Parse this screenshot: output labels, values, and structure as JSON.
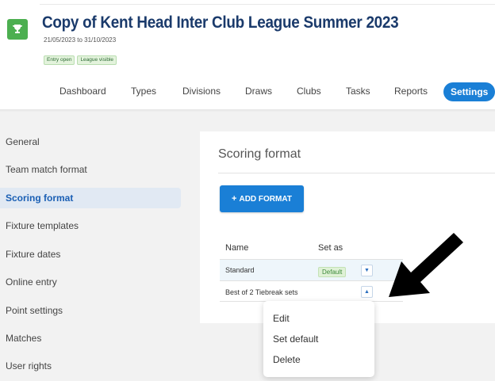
{
  "header": {
    "title": "Copy of Kent Head Inter Club League Summer 2023",
    "dates": "21/05/2023 to 31/10/2023",
    "tags": [
      "Entry open",
      "League visible"
    ]
  },
  "nav": {
    "items": [
      "Dashboard",
      "Types",
      "Divisions",
      "Draws",
      "Clubs",
      "Tasks",
      "Reports",
      "Settings"
    ],
    "active": "Settings"
  },
  "sidebar": {
    "items": [
      "General",
      "Team match format",
      "Scoring format",
      "Fixture templates",
      "Fixture dates",
      "Online entry",
      "Point settings",
      "Matches",
      "User rights"
    ],
    "active": "Scoring format"
  },
  "main": {
    "title": "Scoring format",
    "add_button": "ADD FORMAT",
    "table": {
      "headers": [
        "Name",
        "Set as"
      ],
      "rows": [
        {
          "name": "Standard",
          "badge": "Default"
        },
        {
          "name": "Best of 2 Tiebreak sets",
          "badge": ""
        }
      ]
    },
    "menu": [
      "Edit",
      "Set default",
      "Delete"
    ]
  },
  "icons": {
    "trophy": "trophy-icon",
    "plus": "plus-icon",
    "dropdown": "chevron-down-icon",
    "dropup": "chevron-up-icon",
    "annotation": "arrow-annotation"
  },
  "colors": {
    "primary": "#1a7fd6",
    "title": "#1a3a6b",
    "trophy_bg": "#4caf50",
    "badge_bg": "#dff1d6"
  }
}
